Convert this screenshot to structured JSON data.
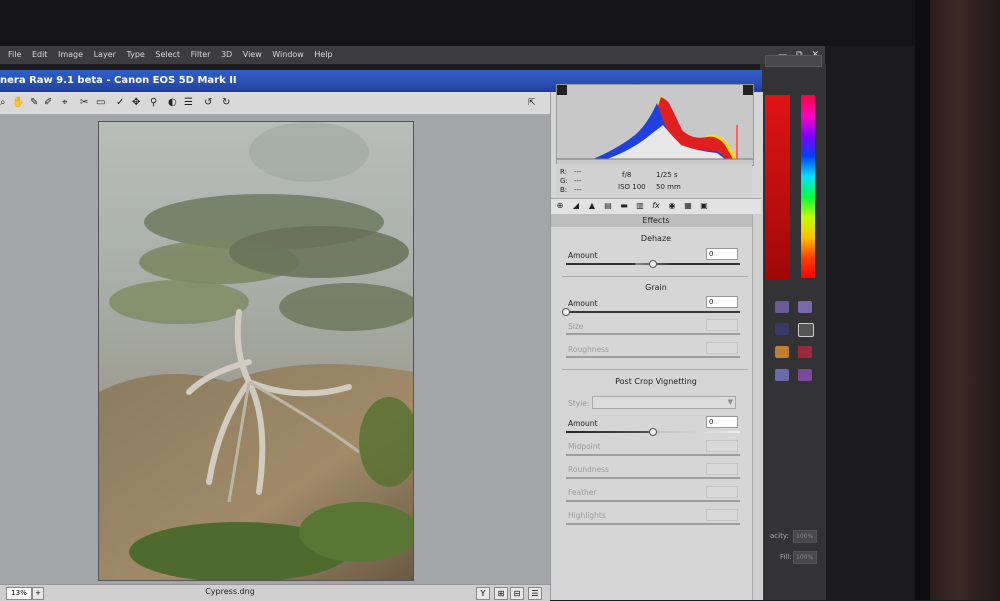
{
  "ps": {
    "menu": [
      "File",
      "Edit",
      "Image",
      "Layer",
      "Type",
      "Select",
      "Filter",
      "3D",
      "View",
      "Window",
      "Help"
    ],
    "win_btns": [
      "—",
      "⧉",
      "✕"
    ],
    "fields": [
      "acity:",
      "100%",
      "Fill:",
      "100%"
    ]
  },
  "camera_raw": {
    "title": "nera Raw 9.1 beta  -  Canon EOS 5D Mark II",
    "tools": [
      "⌕",
      "✋",
      "✎",
      "✐",
      "⌖",
      "✂",
      "▭",
      "✓",
      "✥",
      "⚲",
      "◐",
      "☰",
      "↺",
      "↻"
    ],
    "zoom": "13%",
    "zoom_btn": "+",
    "filename": "Cypress.dng",
    "bottom_btns": [
      "Y",
      "⊞",
      "⊟",
      "☰"
    ],
    "hist_info": {
      "r": "R:",
      "g": "G:",
      "b": "B:",
      "r_val": "---",
      "g_val": "---",
      "b_val": "---",
      "aperture": "f/8",
      "shutter": "1/25 s",
      "iso": "ISO 100",
      "focal": "50 mm"
    },
    "panel_tabs": [
      "⊕",
      "◢",
      "▲",
      "▤",
      "▬",
      "▥",
      "fx",
      "◉",
      "▦",
      "▣"
    ],
    "effects_header": "Effects",
    "sections": {
      "dehaze": {
        "title": "Dehaze",
        "amount_label": "Amount",
        "amount": "0",
        "amount_level": 0.5
      },
      "grain": {
        "title": "Grain",
        "amount_label": "Amount",
        "amount": "0",
        "amount_level": 0,
        "size_label": "Size",
        "roughness_label": "Roughness"
      },
      "vignette": {
        "title": "Post Crop Vignetting",
        "style_label": "Style:",
        "amount_label": "Amount",
        "amount": "0",
        "amount_level": 0.5,
        "midpoint_label": "Midpoint",
        "roundness_label": "Roundness",
        "feather_label": "Feather",
        "highlights_label": "Highlights"
      }
    }
  }
}
